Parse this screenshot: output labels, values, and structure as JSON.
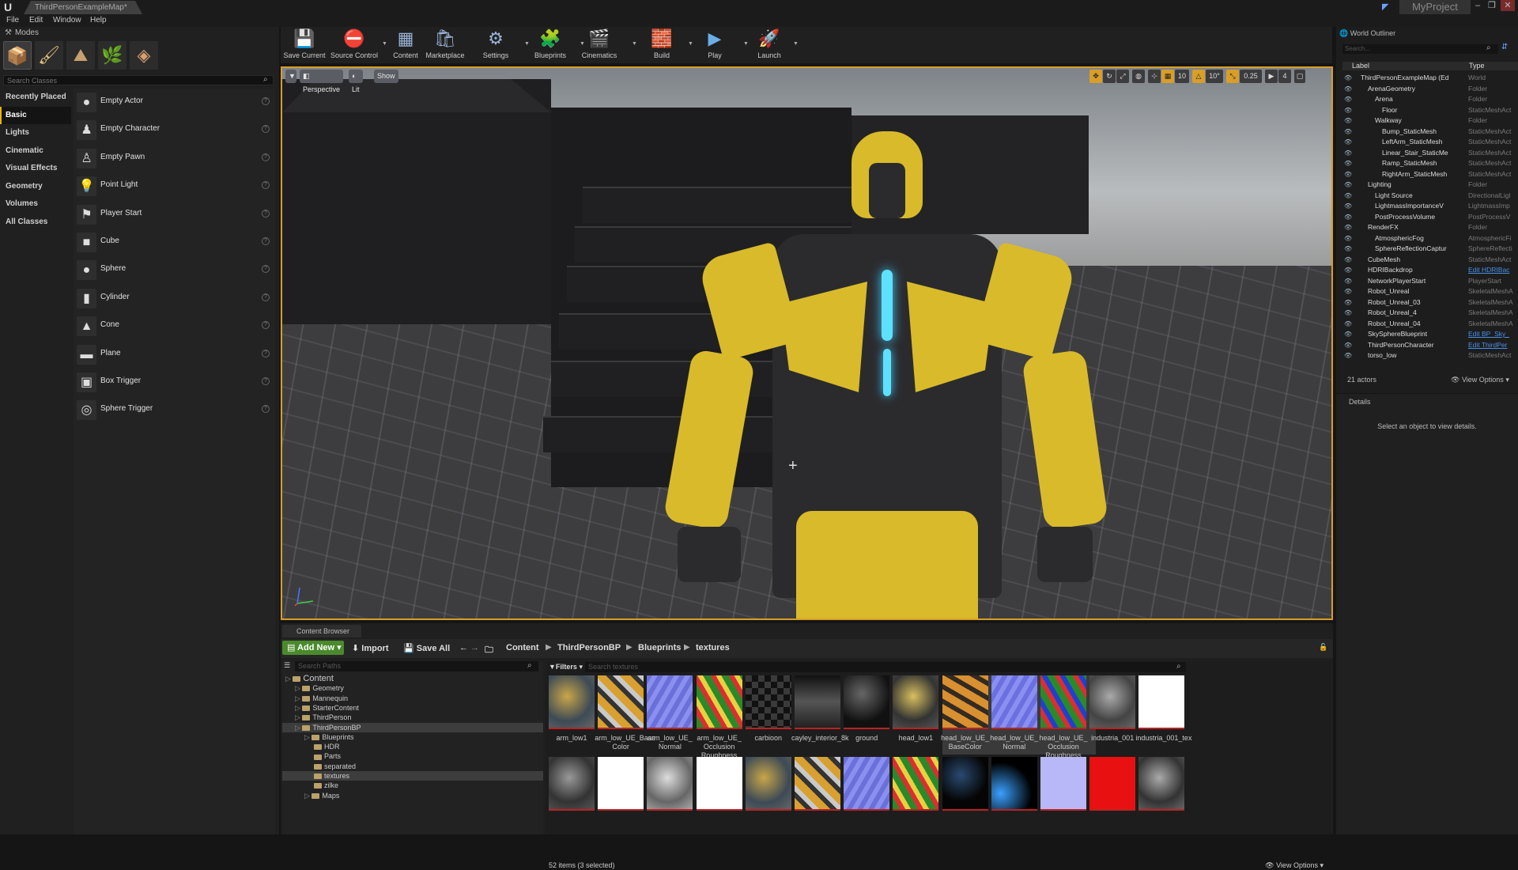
{
  "window": {
    "tab_title": "ThirdPersonExampleMap*",
    "project": "MyProject",
    "min": "–",
    "restore": "❐",
    "close": "✕"
  },
  "menu": [
    "File",
    "Edit",
    "Window",
    "Help"
  ],
  "modes": {
    "tab": "Modes",
    "search_placeholder": "Search Classes",
    "categories": [
      "Recently Placed",
      "Basic",
      "Lights",
      "Cinematic",
      "Visual Effects",
      "Geometry",
      "Volumes",
      "All Classes"
    ],
    "active_category": "Basic",
    "classes": [
      "Empty Actor",
      "Empty Character",
      "Empty Pawn",
      "Point Light",
      "Player Start",
      "Cube",
      "Sphere",
      "Cylinder",
      "Cone",
      "Plane",
      "Box Trigger",
      "Sphere Trigger"
    ]
  },
  "toolbar": [
    "Save Current",
    "Source Control",
    "Content",
    "Marketplace",
    "Settings",
    "Blueprints",
    "Cinematics",
    "Build",
    "Play",
    "Launch"
  ],
  "viewport": {
    "perspective": "Perspective",
    "lit": "Lit",
    "show": "Show",
    "grid": "10",
    "rot": "10°",
    "scale": "0.25",
    "cam": "4"
  },
  "content_browser": {
    "tab": "Content Browser",
    "add_new": "Add New",
    "import": "Import",
    "save_all": "Save All",
    "breadcrumbs": [
      "Content",
      "ThirdPersonBP",
      "Blueprints",
      "textures"
    ],
    "search_paths": "Search Paths",
    "filters": "Filters",
    "search_assets": "Search textures",
    "tree": [
      {
        "label": "Content",
        "depth": 0
      },
      {
        "label": "Geometry",
        "depth": 1
      },
      {
        "label": "Mannequin",
        "depth": 1
      },
      {
        "label": "StarterContent",
        "depth": 1
      },
      {
        "label": "ThirdPerson",
        "depth": 1
      },
      {
        "label": "ThirdPersonBP",
        "depth": 1
      },
      {
        "label": "Blueprints",
        "depth": 2
      },
      {
        "label": "HDR",
        "depth": 3
      },
      {
        "label": "Parts",
        "depth": 3
      },
      {
        "label": "separated",
        "depth": 3
      },
      {
        "label": "textures",
        "depth": 3
      },
      {
        "label": "zilke",
        "depth": 3
      },
      {
        "label": "Maps",
        "depth": 2
      }
    ],
    "assets_row1": [
      "arm_low1",
      "arm_low_UE_Base Color",
      "arm_low_UE_ Normal",
      "arm_low_UE_ Occlusion Roughness",
      "carbioon",
      "cayley_interior_8k",
      "ground",
      "head_low1",
      "head_low_UE_ BaseColor",
      "head_low_UE_ Normal",
      "head_low_UE_ Occlusion Roughness",
      "industria_001",
      "industria_001_tex"
    ],
    "items": "52 items (3 selected)",
    "view_options": "View Options"
  },
  "outliner": {
    "tab": "World Outliner",
    "search": "Search...",
    "col_label": "Label",
    "col_type": "Type",
    "rows": [
      {
        "label": "ThirdPersonExampleMap (Ed",
        "type": "World",
        "indent": 1,
        "link": false
      },
      {
        "label": "ArenaGeometry",
        "type": "Folder",
        "indent": 2,
        "link": false
      },
      {
        "label": "Arena",
        "type": "Folder",
        "indent": 3,
        "link": false
      },
      {
        "label": "Floor",
        "type": "StaticMeshAct",
        "indent": 4,
        "link": false
      },
      {
        "label": "Walkway",
        "type": "Folder",
        "indent": 3,
        "link": false
      },
      {
        "label": "Bump_StaticMesh",
        "type": "StaticMeshAct",
        "indent": 4,
        "link": false
      },
      {
        "label": "LeftArm_StaticMesh",
        "type": "StaticMeshAct",
        "indent": 4,
        "link": false
      },
      {
        "label": "Linear_Stair_StaticMe",
        "type": "StaticMeshAct",
        "indent": 4,
        "link": false
      },
      {
        "label": "Ramp_StaticMesh",
        "type": "StaticMeshAct",
        "indent": 4,
        "link": false
      },
      {
        "label": "RightArm_StaticMesh",
        "type": "StaticMeshAct",
        "indent": 4,
        "link": false
      },
      {
        "label": "Lighting",
        "type": "Folder",
        "indent": 2,
        "link": false
      },
      {
        "label": "Light Source",
        "type": "DirectionalLigl",
        "indent": 3,
        "link": false
      },
      {
        "label": "LightmassImportanceV",
        "type": "LightmassImp",
        "indent": 3,
        "link": false
      },
      {
        "label": "PostProcessVolume",
        "type": "PostProcessV",
        "indent": 3,
        "link": false
      },
      {
        "label": "RenderFX",
        "type": "Folder",
        "indent": 2,
        "link": false
      },
      {
        "label": "AtmosphericFog",
        "type": "AtmosphericFi",
        "indent": 3,
        "link": false
      },
      {
        "label": "SphereReflectionCaptur",
        "type": "SphereReflecti",
        "indent": 3,
        "link": false
      },
      {
        "label": "CubeMesh",
        "type": "StaticMeshAct",
        "indent": 2,
        "link": false
      },
      {
        "label": "HDRIBackdrop",
        "type": "Edit HDRIBac",
        "indent": 2,
        "link": true
      },
      {
        "label": "NetworkPlayerStart",
        "type": "PlayerStart",
        "indent": 2,
        "link": false
      },
      {
        "label": "Robot_Unreal",
        "type": "SkeletalMeshA",
        "indent": 2,
        "link": false
      },
      {
        "label": "Robot_Unreal_03",
        "type": "SkeletalMeshA",
        "indent": 2,
        "link": false
      },
      {
        "label": "Robot_Unreal_4",
        "type": "SkeletalMeshA",
        "indent": 2,
        "link": false
      },
      {
        "label": "Robot_Unreal_04",
        "type": "SkeletalMeshA",
        "indent": 2,
        "link": false
      },
      {
        "label": "SkySphereBlueprint",
        "type": "Edit BP_Sky_",
        "indent": 2,
        "link": true
      },
      {
        "label": "ThirdPersonCharacter",
        "type": "Edit ThirdPer",
        "indent": 2,
        "link": true
      },
      {
        "label": "torso_low",
        "type": "StaticMeshAct",
        "indent": 2,
        "link": false
      }
    ],
    "count": "21 actors",
    "view_options": "View Options"
  },
  "details": {
    "tab": "Details",
    "message": "Select an object to view details."
  },
  "colors": {
    "accent": "#d89e28",
    "add_new": "#4a8a2c",
    "link": "#4a90e8"
  }
}
